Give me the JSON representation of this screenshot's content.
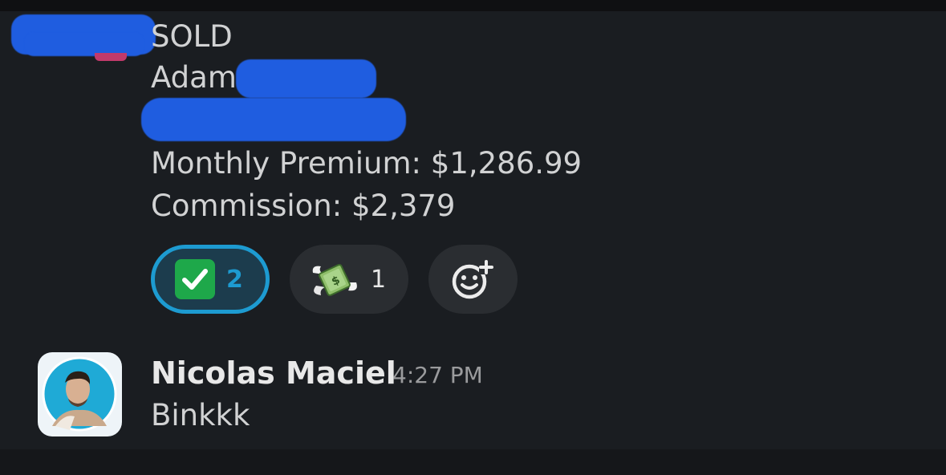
{
  "message1": {
    "status": "SOLD",
    "client_first_name": "Adam",
    "premium_line": "Monthly Premium: $1,286.99",
    "commission_line": "Commission: $2,379"
  },
  "reactions": [
    {
      "emoji": "white-check-mark",
      "count": "2",
      "selected": true
    },
    {
      "emoji": "money-with-wings",
      "count": "1",
      "selected": false
    }
  ],
  "message2": {
    "author": "Nicolas Maciel",
    "time": "4:27 PM",
    "text": "Binkkk"
  },
  "colors": {
    "background": "#1a1d21",
    "text": "#d1d2d3",
    "accent": "#1d9bd1",
    "reaction_bg": "#2a2d31",
    "redaction": "#1f5de0"
  }
}
